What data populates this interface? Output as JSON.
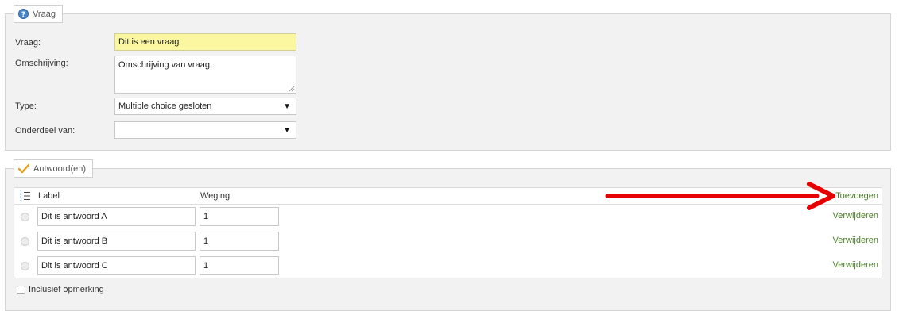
{
  "vraag_section": {
    "legend": "Vraag",
    "fields": {
      "vraag": {
        "label": "Vraag:",
        "value": "Dit is een vraag"
      },
      "omschrijving": {
        "label": "Omschrijving:",
        "value": "Omschrijving van vraag."
      },
      "type": {
        "label": "Type:",
        "value": "Multiple choice gesloten"
      },
      "onderdeel": {
        "label": "Onderdeel van:",
        "value": ""
      }
    }
  },
  "antwoorden_section": {
    "legend": "Antwoord(en)",
    "columns": {
      "label": "Label",
      "weging": "Weging"
    },
    "add_link": "Toevoegen",
    "rows": [
      {
        "label": "Dit is antwoord A",
        "weging": "1",
        "remove": "Verwijderen"
      },
      {
        "label": "Dit is antwoord B",
        "weging": "1",
        "remove": "Verwijderen"
      },
      {
        "label": "Dit is antwoord C",
        "weging": "1",
        "remove": "Verwijderen"
      }
    ],
    "checkbox_label": "Inclusief opmerking"
  },
  "colors": {
    "accent_link": "#4b7f29",
    "highlight_input": "#fbf7a1",
    "annotation_arrow": "#e60000"
  },
  "icons": [
    "help-icon",
    "checkmark-icon",
    "list-order-icon",
    "chevron-down-icon",
    "resize-handle-icon"
  ]
}
